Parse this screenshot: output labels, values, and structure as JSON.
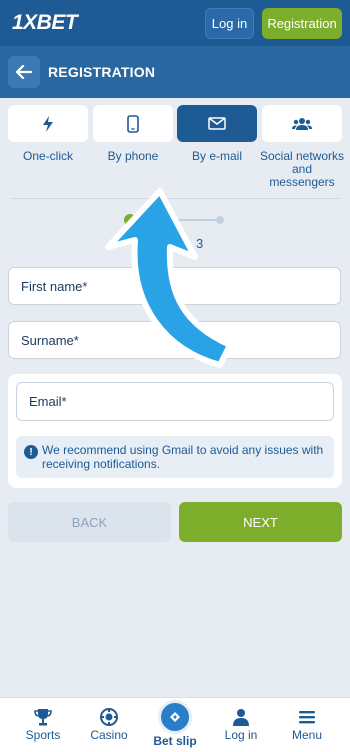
{
  "header": {
    "logo": "1XBET",
    "login_label": "Log in",
    "registration_label": "Registration"
  },
  "subheader": {
    "title": "REGISTRATION",
    "back_icon": "arrow-left-icon"
  },
  "tabs": [
    {
      "label": "One-click",
      "icon": "lightning-icon",
      "active": false
    },
    {
      "label": "By phone",
      "icon": "phone-icon",
      "active": false
    },
    {
      "label": "By e-mail",
      "icon": "envelope-icon",
      "active": true
    },
    {
      "label": "Social networks and messengers",
      "icon": "users-icon",
      "active": false
    }
  ],
  "stepper": {
    "step_label": "3"
  },
  "form": {
    "first_name_placeholder": "First name*",
    "surname_placeholder": "Surname*",
    "email_placeholder": "Email*",
    "notice": "We recommend using Gmail to avoid any issues with receiving notifications."
  },
  "actions": {
    "back_label": "BACK",
    "next_label": "NEXT"
  },
  "bottom_nav": [
    {
      "label": "Sports",
      "icon": "trophy-icon"
    },
    {
      "label": "Casino",
      "icon": "casino-chip-icon"
    },
    {
      "label": "Bet slip",
      "icon": "ticket-icon"
    },
    {
      "label": "Log in",
      "icon": "user-icon"
    },
    {
      "label": "Menu",
      "icon": "menu-icon"
    }
  ],
  "colors": {
    "brand_dark": "#1e5a94",
    "brand_mid": "#2a67a1",
    "accent_green": "#7cae2c",
    "arrow_blue": "#2aa3e6"
  }
}
